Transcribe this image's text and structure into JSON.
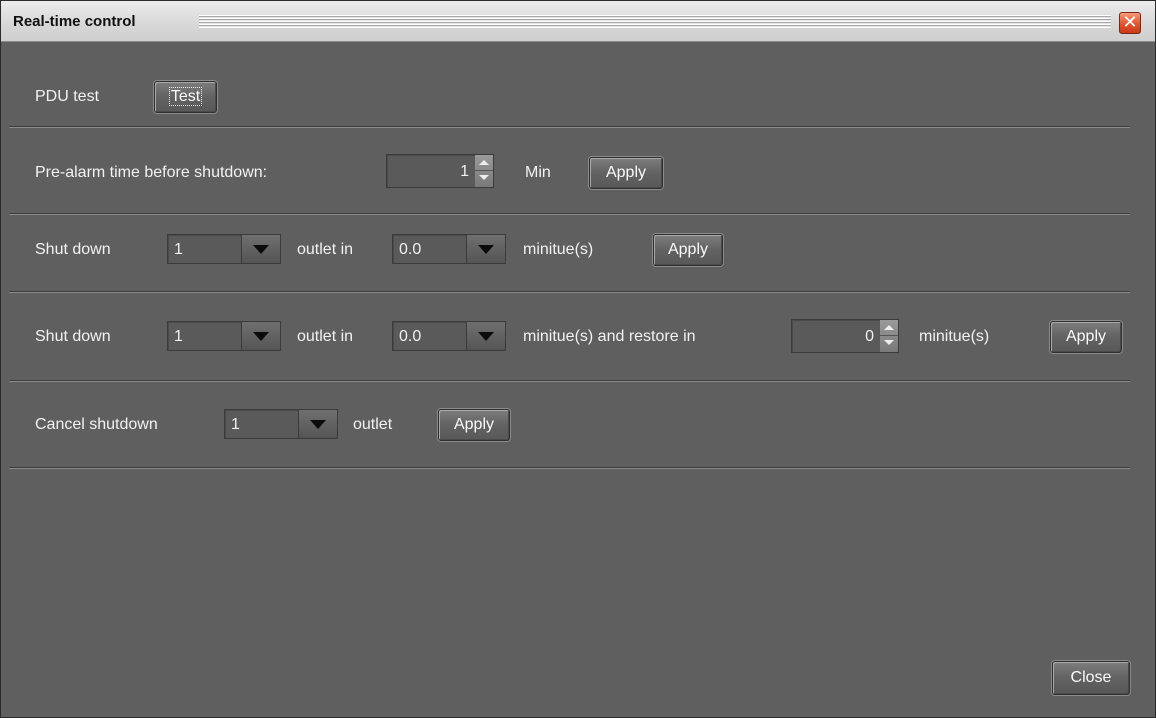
{
  "window": {
    "title": "Real-time control",
    "close_icon": "close-x-icon"
  },
  "pdu_test": {
    "label": "PDU test",
    "button": "Test"
  },
  "pre_alarm": {
    "label": "Pre-alarm time before shutdown:",
    "value": "1",
    "unit": "Min",
    "apply": "Apply"
  },
  "shutdown": {
    "label": "Shut down",
    "outlet": "1",
    "outlet_in": "outlet in",
    "delay": "0.0",
    "unit": "minitue(s)",
    "apply": "Apply"
  },
  "shutdown_restore": {
    "label": "Shut down",
    "outlet": "1",
    "outlet_in": "outlet in",
    "delay": "0.0",
    "restore_text": "minitue(s) and restore in",
    "restore_value": "0",
    "unit": "minitue(s)",
    "apply": "Apply"
  },
  "cancel_shutdown": {
    "label": "Cancel shutdown",
    "outlet": "1",
    "outlet_text": "outlet",
    "apply": "Apply"
  },
  "footer": {
    "close": "Close"
  }
}
